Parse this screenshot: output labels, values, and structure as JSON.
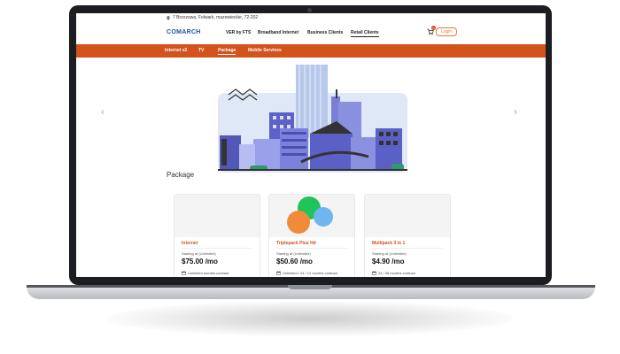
{
  "header": {
    "address": "7 Brzozowa, Folwark, mazowieckie, 72-202",
    "logo": "COMARCH",
    "nav": [
      "VER by FTS",
      "Broadband Internet",
      "Business Clients",
      "Retail Clients"
    ],
    "cart_count": "0",
    "login_label": "Login"
  },
  "subnav": [
    "Internet v2",
    "TV",
    "Package",
    "Mobile Services"
  ],
  "main": {
    "section_title": "Package",
    "prev_icon": "chevron-left-icon",
    "next_icon": "chevron-right-icon",
    "cards": [
      {
        "name": "Internet",
        "starting": "Starting at (Unlimited)",
        "price": "$75.00 /mo",
        "contract": "Unlimited months contract"
      },
      {
        "name": "Triplepack Plus Hd",
        "starting": "Starting at (Unlimited)",
        "price": "$50.60 /mo",
        "contract": "Unlimited / 24 / 12 months contract"
      },
      {
        "name": "Multipack 3 in 1",
        "starting": "Starting at (Unlimited)",
        "price": "$4.90 /mo",
        "contract": "24 / 36 months contract"
      }
    ]
  },
  "colors": {
    "accent": "#d4521c",
    "logo": "#1f4fa3"
  }
}
